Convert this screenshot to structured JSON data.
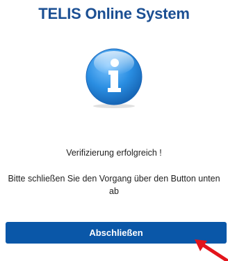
{
  "header": {
    "title": "TELIS Online System"
  },
  "status_icon": "info-icon",
  "messages": {
    "status": "Verifizierung erfolgreich !",
    "instruction": "Bitte schließen Sie den Vorgang über den Button unten ab"
  },
  "actions": {
    "finish_label": "Abschließen"
  },
  "annotation": {
    "pointer": "red-arrow-icon"
  },
  "colors": {
    "title": "#1b4f93",
    "button": "#0a57a8",
    "icon_circle": "#2b8fe0",
    "arrow": "#e3141b"
  }
}
